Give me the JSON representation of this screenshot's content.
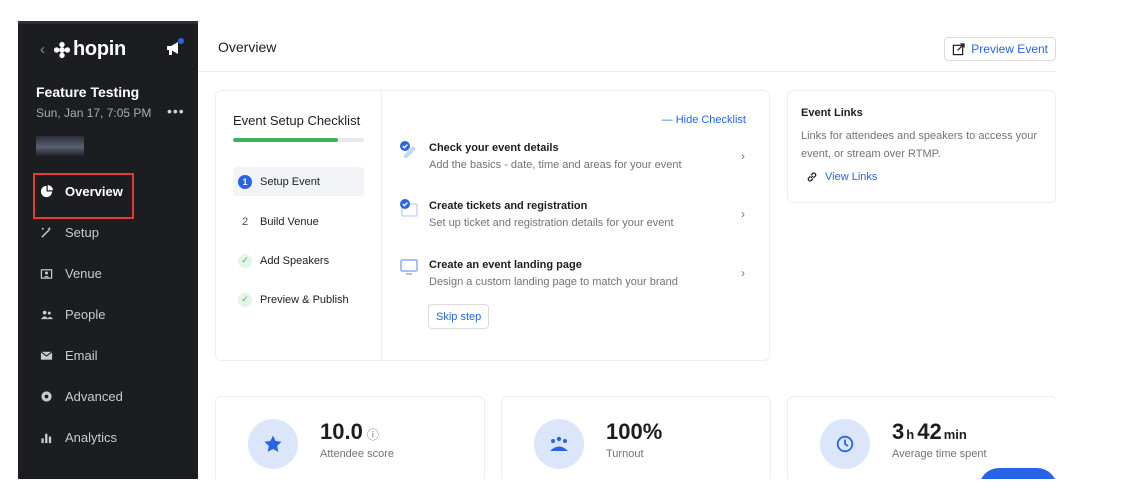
{
  "sidebar": {
    "brand": "hopin",
    "event_title": "Feature Testing",
    "event_date": "Sun, Jan 17, 7:05 PM",
    "more": "•••",
    "nav": [
      {
        "label": "Overview",
        "icon": "pie-chart-icon",
        "active": true
      },
      {
        "label": "Setup",
        "icon": "wand-icon"
      },
      {
        "label": "Venue",
        "icon": "venue-icon"
      },
      {
        "label": "People",
        "icon": "people-icon"
      },
      {
        "label": "Email",
        "icon": "envelope-icon"
      },
      {
        "label": "Advanced",
        "icon": "gear-icon"
      },
      {
        "label": "Analytics",
        "icon": "bar-chart-icon"
      }
    ]
  },
  "header": {
    "title": "Overview",
    "preview_label": "Preview Event"
  },
  "checklist": {
    "title": "Event Setup Checklist",
    "progress": 0.8,
    "hide_label": "Hide Checklist",
    "steps": [
      {
        "badge": "1",
        "label": "Setup Event",
        "state": "current"
      },
      {
        "badge": "2",
        "label": "Build Venue",
        "state": "todo"
      },
      {
        "badge": "✓",
        "label": "Add Speakers",
        "state": "done"
      },
      {
        "badge": "✓",
        "label": "Preview & Publish",
        "state": "done"
      }
    ],
    "tasks": [
      {
        "name": "Check your event details",
        "desc": "Add the basics - date, time and areas for your event",
        "icon": "pencil-check-icon"
      },
      {
        "name": "Create tickets and registration",
        "desc": "Set up ticket and registration details for your event",
        "icon": "ticket-check-icon"
      },
      {
        "name": "Create an event landing page",
        "desc": "Design a custom landing page to match your brand",
        "icon": "monitor-icon"
      }
    ],
    "skip_label": "Skip step"
  },
  "links": {
    "title": "Event Links",
    "desc": "Links for attendees and speakers to access your event, or stream over RTMP.",
    "view_label": "View Links"
  },
  "stats": [
    {
      "value": "10.0",
      "unit": "",
      "value2": "",
      "unit2": "",
      "info": "ⓘ",
      "label": "Attendee score",
      "icon": "star-icon"
    },
    {
      "value": "100%",
      "unit": "",
      "value2": "",
      "unit2": "",
      "info": "",
      "label": "Turnout",
      "icon": "people-group-icon"
    },
    {
      "value": "3",
      "unit": "h",
      "value2": "42",
      "unit2": "min",
      "info": "",
      "label": "Average time spent",
      "icon": "clock-icon"
    }
  ],
  "colors": {
    "accent": "#2764e8",
    "success": "#3db25b",
    "sidebar": "#1c1d21",
    "highlight": "#e53935"
  }
}
